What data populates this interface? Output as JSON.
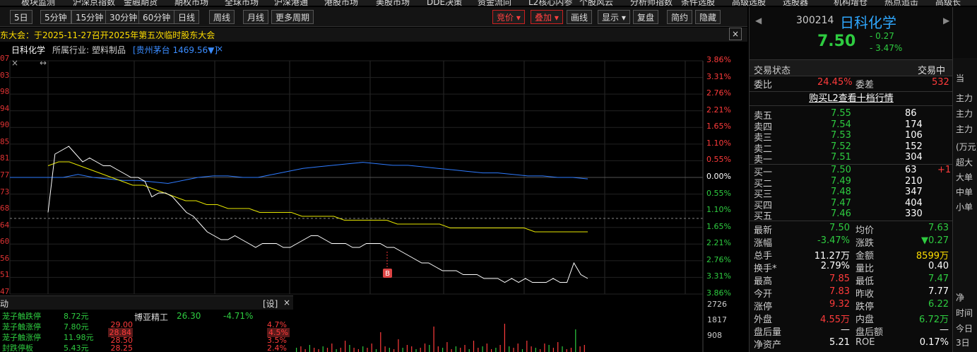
{
  "top_nav": [
    "板块监测",
    "沪深京指数",
    "金融期货",
    "期权市场",
    "全球市场",
    "沪深港通",
    "港股市场",
    "美股市场",
    "DDE决策",
    "资金流向",
    "L2核心内参",
    "个股风云",
    "分析师指数",
    "条件选股",
    "高级选股",
    "选股器",
    "机构增仓",
    "热点追击",
    "高级长"
  ],
  "toolbar": {
    "periods": [
      "5日",
      "5分钟",
      "15分钟",
      "30分钟",
      "60分钟",
      "日线",
      "周线",
      "月线",
      "更多周期"
    ],
    "right_buttons": [
      "竞价",
      "叠加",
      "画线",
      "显示",
      "复盘",
      "简约",
      "隐藏"
    ]
  },
  "notice": "东大会：于2025-11-27召开2025年第五次临时股东大会",
  "chart_header": {
    "name": "日科化学",
    "industry_label": "所属行业:",
    "industry": "塑料制品",
    "overlay": "[贵州茅台 1469.56▼]",
    "close_x": "×"
  },
  "chart_data": {
    "type": "line",
    "left_ticks": [
      "07",
      "03",
      "98",
      "94",
      "90",
      "85",
      "81",
      "77",
      "73",
      "68",
      "64",
      "60",
      "56",
      "51",
      "47"
    ],
    "right_ticks": [
      "3.86%",
      "3.31%",
      "2.76%",
      "2.21%",
      "1.65%",
      "1.10%",
      "0.55%",
      "0.00%",
      "0.55%",
      "1.10%",
      "1.65%",
      "2.21%",
      "2.76%",
      "3.31%",
      "3.86%"
    ],
    "prev_close": 7.77,
    "price_series": [
      7.68,
      7.83,
      7.84,
      7.85,
      7.83,
      7.81,
      7.82,
      7.81,
      7.8,
      7.8,
      7.79,
      7.78,
      7.77,
      7.77,
      7.76,
      7.72,
      7.73,
      7.73,
      7.72,
      7.7,
      7.68,
      7.67,
      7.65,
      7.63,
      7.62,
      7.61,
      7.61,
      7.62,
      7.61,
      7.6,
      7.59,
      7.6,
      7.6,
      7.6,
      7.59,
      7.59,
      7.6,
      7.61,
      7.62,
      7.62,
      7.61,
      7.6,
      7.6,
      7.6,
      7.59,
      7.59,
      7.6,
      7.6,
      7.6,
      7.59,
      7.59,
      7.58,
      7.57,
      7.56,
      7.55,
      7.55,
      7.54,
      7.53,
      7.53,
      7.53,
      7.52,
      7.52,
      7.52,
      7.51,
      7.51,
      7.51,
      7.5,
      7.51,
      7.5,
      7.51,
      7.5,
      7.5,
      7.5,
      7.51,
      7.5,
      7.5,
      7.55,
      7.52,
      7.51
    ],
    "avg_series": [
      7.8,
      7.81,
      7.81,
      7.8,
      7.79,
      7.78,
      7.77,
      7.76,
      7.75,
      7.75,
      7.74,
      7.73,
      7.72,
      7.71,
      7.71,
      7.7,
      7.7,
      7.69,
      7.69,
      7.69,
      7.68,
      7.68,
      7.68,
      7.68,
      7.67,
      7.67,
      7.67,
      7.67,
      7.66,
      7.66,
      7.66,
      7.66,
      7.66,
      7.65,
      7.65,
      7.65,
      7.65,
      7.65,
      7.64,
      7.64,
      7.64,
      7.64,
      7.64,
      7.64,
      7.64,
      7.64,
      7.63,
      7.63,
      7.63,
      7.63,
      7.63,
      7.63
    ],
    "bench_series": [
      0.0,
      0.0,
      0.1,
      0.0,
      -0.05,
      -0.1,
      -0.1,
      -0.15,
      -0.2,
      -0.1,
      0.0,
      0.05,
      0.05,
      0.0,
      0.0,
      0.1,
      0.2,
      0.3,
      0.35,
      0.4,
      0.45,
      0.5,
      0.45,
      0.4,
      0.4,
      0.35,
      0.3,
      0.25,
      0.2,
      0.15,
      0.15,
      0.1,
      0.05,
      0.05,
      0.0,
      0.0,
      -0.05
    ],
    "marker": "B",
    "volume_ticks": [
      "2726",
      "1817",
      "908"
    ]
  },
  "sidebar_list": {
    "title": "动",
    "settings": "[设]",
    "close": "×",
    "items": [
      {
        "name": "茏子触跌停",
        "val": "8.72元"
      },
      {
        "name": "茏子触涨停",
        "val": "7.80元"
      },
      {
        "name": "茏子触涨停",
        "val": "11.98元"
      },
      {
        "name": "封跌停板",
        "val": "5.43元"
      }
    ],
    "stock": {
      "name": "博亚精工",
      "price": "26.30",
      "chg": "-4.71%"
    },
    "prices": [
      "29.00",
      "28.84",
      "28.50",
      "28.25"
    ],
    "pcts": [
      "4.7%",
      "4.5%",
      "3.5%",
      "2.4%"
    ]
  },
  "quote": {
    "code": "300214",
    "name": "日科化学",
    "price": "7.50",
    "chg": "- 0.27",
    "pct": "- 3.47%",
    "status_label": "交易状态",
    "status": "交易中",
    "ratio_label": "委比",
    "ratio": "24.45%",
    "diff_label": "委差",
    "diff": "532",
    "l2_link": "购买L2查看十档行情",
    "asks": [
      {
        "label": "卖五",
        "price": "7.55",
        "vol": "86"
      },
      {
        "label": "卖四",
        "price": "7.54",
        "vol": "174"
      },
      {
        "label": "卖三",
        "price": "7.53",
        "vol": "106"
      },
      {
        "label": "卖二",
        "price": "7.52",
        "vol": "152"
      },
      {
        "label": "卖一",
        "price": "7.51",
        "vol": "304"
      }
    ],
    "bids": [
      {
        "label": "买一",
        "price": "7.50",
        "vol": "63",
        "chg": "+1"
      },
      {
        "label": "买二",
        "price": "7.49",
        "vol": "210",
        "chg": ""
      },
      {
        "label": "买三",
        "price": "7.48",
        "vol": "347",
        "chg": ""
      },
      {
        "label": "买四",
        "price": "7.47",
        "vol": "404",
        "chg": ""
      },
      {
        "label": "买五",
        "price": "7.46",
        "vol": "330",
        "chg": ""
      }
    ],
    "stats": [
      [
        {
          "l": "最新",
          "v": "7.50",
          "c": "green"
        },
        {
          "l": "均价",
          "v": "7.63",
          "c": "green"
        }
      ],
      [
        {
          "l": "涨幅",
          "v": "-3.47%",
          "c": "green"
        },
        {
          "l": "涨跌",
          "v": "▼0.27",
          "c": "green"
        }
      ],
      [
        {
          "l": "总手",
          "v": "11.27万",
          "c": "white"
        },
        {
          "l": "金额",
          "v": "8599万",
          "c": "yellow"
        }
      ],
      [
        {
          "l": "换手*",
          "v": "2.79%",
          "c": "white"
        },
        {
          "l": "量比",
          "v": "0.40",
          "c": "white"
        }
      ],
      [
        {
          "l": "最高",
          "v": "7.85",
          "c": "red"
        },
        {
          "l": "最低",
          "v": "7.47",
          "c": "green"
        }
      ],
      [
        {
          "l": "今开",
          "v": "7.83",
          "c": "red"
        },
        {
          "l": "昨收",
          "v": "7.77",
          "c": "white"
        }
      ],
      [
        {
          "l": "涨停",
          "v": "9.32",
          "c": "red"
        },
        {
          "l": "跌停",
          "v": "6.22",
          "c": "green"
        }
      ],
      [
        {
          "l": "外盘",
          "v": "4.55万",
          "c": "red"
        },
        {
          "l": "内盘",
          "v": "6.72万",
          "c": "green"
        }
      ],
      [
        {
          "l": "盘后量",
          "v": "—",
          "c": "white"
        },
        {
          "l": "盘后额",
          "v": "—",
          "c": "white"
        }
      ],
      [
        {
          "l": "净资产",
          "v": "5.21",
          "c": "white"
        },
        {
          "l": "ROE",
          "v": "0.17%",
          "c": "white"
        }
      ]
    ]
  },
  "far_panel": [
    "当",
    "主力",
    "主力",
    "主力",
    "(万元)",
    "超大",
    "大单",
    "中单",
    "小单",
    "净",
    "时间",
    "今日",
    "3日"
  ]
}
